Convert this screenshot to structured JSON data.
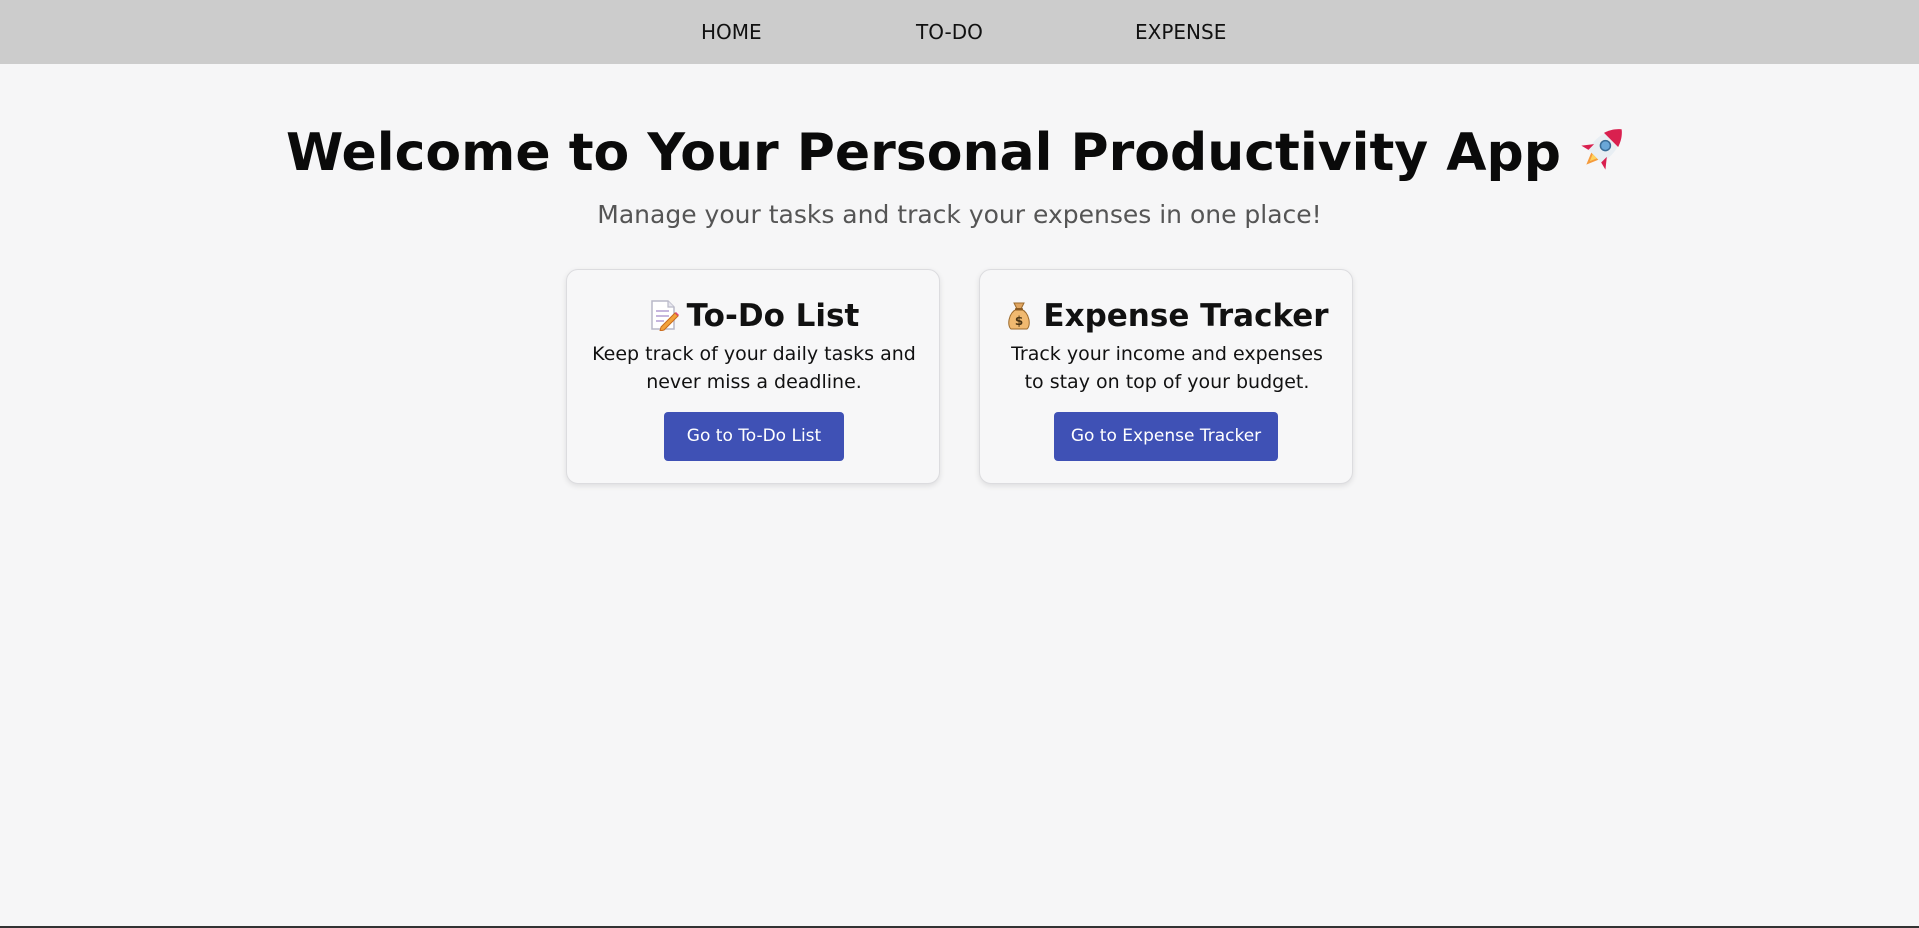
{
  "nav": {
    "items": [
      {
        "label": "HOME"
      },
      {
        "label": "TO-DO"
      },
      {
        "label": "EXPENSE"
      }
    ]
  },
  "hero": {
    "title": "Welcome to Your Personal Productivity App",
    "title_icon": "rocket-icon",
    "subtitle": "Manage your tasks and track your expenses in one place!"
  },
  "cards": [
    {
      "icon": "memo-icon",
      "title": "To-Do List",
      "description": "Keep track of your daily tasks and never miss a deadline.",
      "button_label": "Go to To-Do List"
    },
    {
      "icon": "money-bag-icon",
      "title": "Expense Tracker",
      "description": "Track your income and expenses to stay on top of your budget.",
      "button_label": "Go to Expense Tracker"
    }
  ],
  "colors": {
    "navbar": "#cccccc",
    "background": "#f6f6f7",
    "button": "#3f51b5",
    "button_text": "#ffffff"
  }
}
